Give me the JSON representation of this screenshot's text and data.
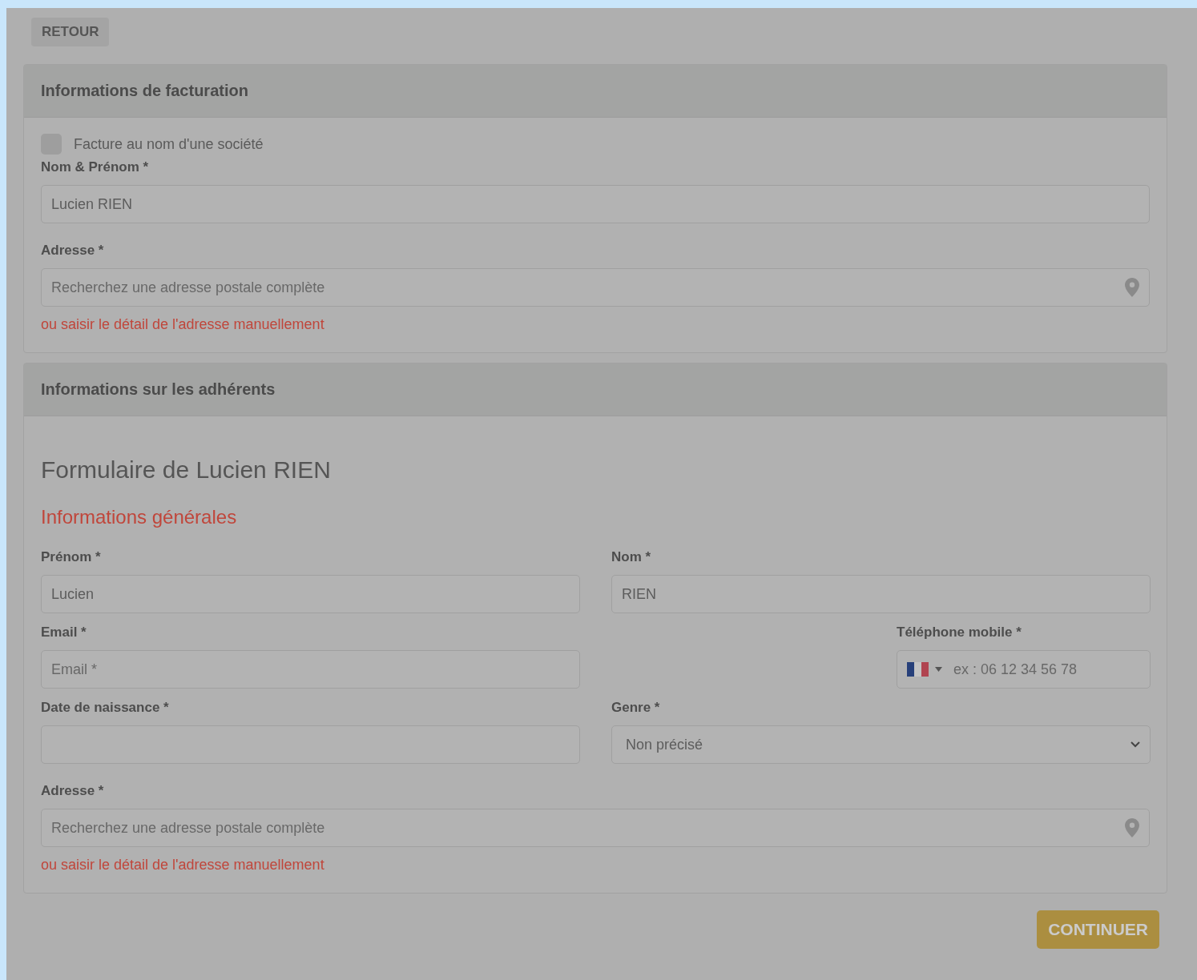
{
  "back_button": "RETOUR",
  "billing": {
    "title": "Informations de facturation",
    "company_checkbox": {
      "label": "Facture au nom d'une société",
      "checked": false
    },
    "name_field": {
      "label": "Nom & Prénom *",
      "value": "Lucien RIEN"
    },
    "address_field": {
      "label": "Adresse *",
      "placeholder": "Recherchez une adresse postale complète"
    },
    "manual_link": "ou saisir le détail de l'adresse manuellement"
  },
  "members": {
    "title": "Informations sur les adhérents",
    "form_title": "Formulaire de Lucien RIEN",
    "section_title": "Informations générales",
    "first_name": {
      "label": "Prénom *",
      "value": "Lucien"
    },
    "last_name": {
      "label": "Nom *",
      "value": "RIEN"
    },
    "email": {
      "label": "Email *",
      "placeholder": "Email *"
    },
    "phone": {
      "label": "Téléphone mobile *",
      "placeholder": "ex : 06 12 34 56 78"
    },
    "birth_date": {
      "label": "Date de naissance *"
    },
    "gender": {
      "label": "Genre *",
      "value": "Non précisé"
    },
    "address": {
      "label": "Adresse *",
      "placeholder": "Recherchez une adresse postale complète"
    },
    "manual_link": "ou saisir le détail de l'adresse manuellement"
  },
  "continue_button": "CONTINUER"
}
